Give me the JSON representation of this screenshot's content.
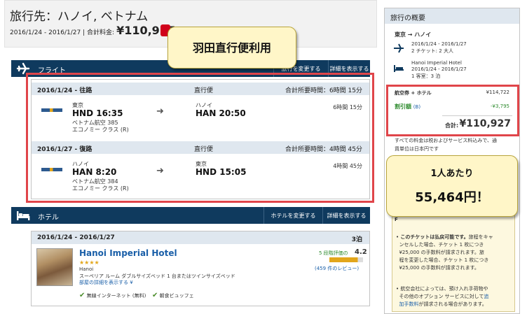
{
  "header": {
    "title": "旅行先：ハノイ, ベトナム",
    "dates": "2016/1/24 - 2016/1/27 | 合計料金:",
    "total": "¥110,927"
  },
  "callout_top": "羽田直行便利用",
  "flight": {
    "section_label": "フライト",
    "change_button": "旅行を変更する",
    "details_button": "詳細を表示する",
    "outbound": {
      "header_date": "2016/1/24 - 往路",
      "header_type": "直行便",
      "header_duration": "合計所要時間：6時間 15分",
      "from_city": "東京",
      "from_time": "HND 16:35",
      "airline": "ベトナム航空 385",
      "cabin": "エコノミー クラス (R)",
      "to_city": "ハノイ",
      "to_time": "HAN 20:50",
      "duration": "6時間 15分"
    },
    "inbound": {
      "header_date": "2016/1/27 - 復路",
      "header_type": "直行便",
      "header_duration": "合計所要時間：4時間 45分",
      "from_city": "ハノイ",
      "from_time": "HAN 8:20",
      "airline": "ベトナム航空 384",
      "cabin": "エコノミー クラス (R)",
      "to_city": "東京",
      "to_time": "HND 15:05",
      "duration": "4時間 45分"
    }
  },
  "hotel": {
    "section_label": "ホテル",
    "change_button": "ホテルを変更する",
    "details_button": "詳細を表示する",
    "dates": "2016/1/24 - 2016/1/27",
    "nights": "3泊",
    "name": "Hanoi Imperial Hotel",
    "stars": "★★★★",
    "city": "Hanoi",
    "room": "スーペリア ルーム ダブルサイズベッド 1 台またはツインサイズベッド",
    "room_link": "部屋の詳細を表示する ¥",
    "rating_label": "5 段階評価の",
    "rating": "4.2",
    "reviews": "(459 件のレビュー)",
    "amenity1": "無線インターネット (無料)",
    "amenity2": "朝食ビュッフェ"
  },
  "summary": {
    "title": "旅行の概要",
    "route": "東京 → ハノイ",
    "flight_dates": "2016/1/24 - 2016/1/27",
    "flight_pax": "2 チケット: 2 大人",
    "hotel_name": "Hanoi Imperial Hotel",
    "hotel_dates": "2016/1/24 - 2016/1/27",
    "hotel_rooms": "1 客室：3 泊",
    "line1_label": "航空券 + ホテル",
    "line1_value": "¥114,722",
    "line2_label": "割引額",
    "line2_suffix": "(B)",
    "line2_value": "-¥3,795",
    "total_label": "合計:",
    "total": "¥110,927",
    "note1": "すべての料金は税およびサービス料込みで、通",
    "note2": "貨単位は日本円です",
    "callout_line1": "1人あたり",
    "callout_line2": "55,464円！",
    "box_r": "F",
    "bullet1_a": "このチケットは払戻可能です。",
    "bullet1_b": "旅程をキャ",
    "bullet1_c": "ンセルした場合、チケット 1 枚につき",
    "bullet1_d": "¥25,000 の手数料が請求されます。旅",
    "bullet1_e": "程を変更した場合、チケット 1 枚につき",
    "bullet1_f": "¥25,000 の手数料が請求されます。",
    "bullet2_a": "航空会社によっては、預け入れ手荷物や",
    "bullet2_b": "その他のオプション サービスに対して",
    "bullet2_c": "追",
    "bullet2_d": "加手数料",
    "bullet2_e": "が請求される場合があります。"
  },
  "colors": {
    "navy": "#0f3a5e",
    "accent_red": "#e0454a",
    "callout_bg": "#fff6c8",
    "link": "#1a5fa8",
    "discount": "#2e8b2e"
  }
}
